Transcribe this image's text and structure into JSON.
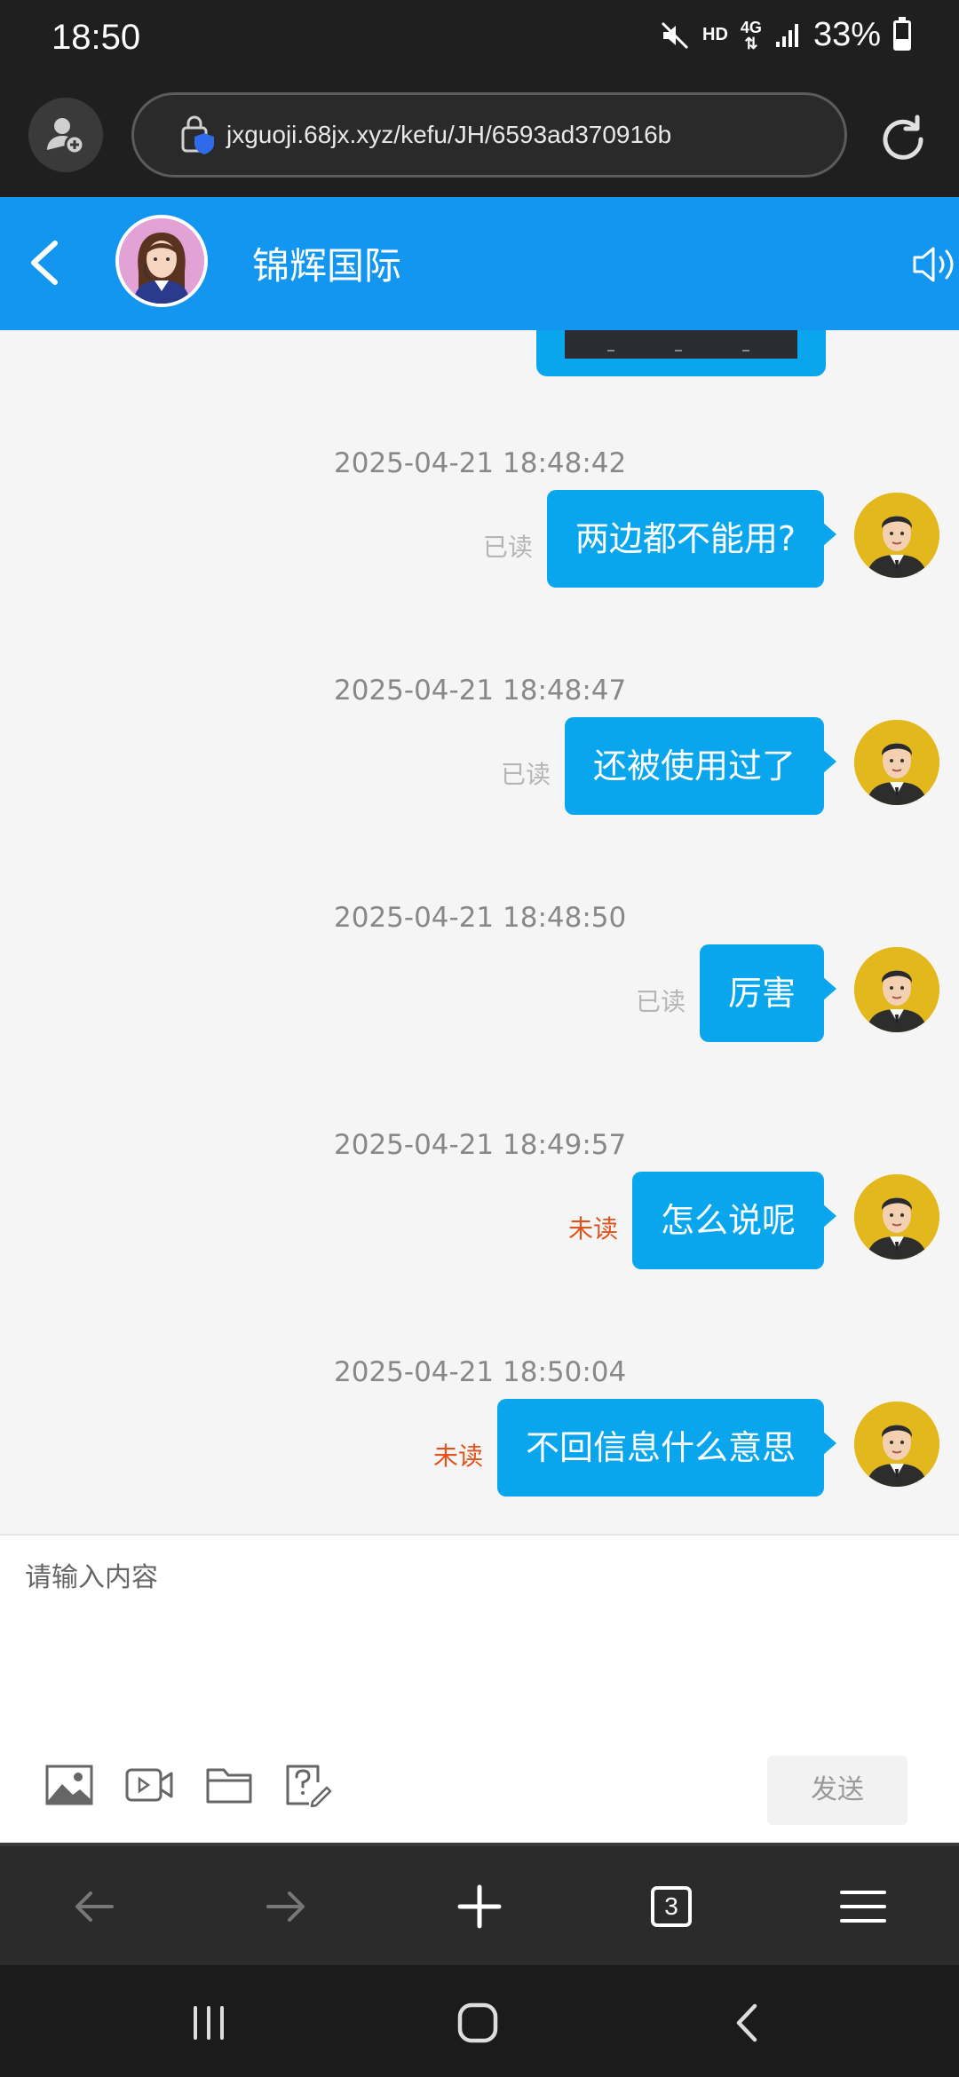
{
  "status_bar": {
    "time": "18:50",
    "hd": "HD",
    "network": "4G",
    "battery": "33%",
    "icons": [
      "mute-icon",
      "signal-icon",
      "battery-icon"
    ]
  },
  "browser": {
    "url": "jxguoji.68jx.xyz/kefu/JH/6593ad370916b",
    "tab_count": "3",
    "icons": [
      "profile-add-icon",
      "secure-lock-icon",
      "reload-icon",
      "back-arrow-icon",
      "forward-arrow-icon",
      "new-tab-icon",
      "tabs-icon",
      "menu-icon"
    ]
  },
  "chat": {
    "title": "锦辉国际",
    "messages": [
      {
        "time": "2025-04-21 18:48:42",
        "status": "已读",
        "text": "两边都不能用?"
      },
      {
        "time": "2025-04-21 18:48:47",
        "status": "已读",
        "text": "还被使用过了"
      },
      {
        "time": "2025-04-21 18:48:50",
        "status": "已读",
        "text": "厉害"
      },
      {
        "time": "2025-04-21 18:49:57",
        "status": "未读",
        "text": "怎么说呢"
      },
      {
        "time": "2025-04-21 18:50:04",
        "status": "未读",
        "text": "不回信息什么意思"
      }
    ]
  },
  "input": {
    "placeholder": "请输入内容",
    "send_label": "发送",
    "tools": [
      "image-icon",
      "video-icon",
      "folder-icon",
      "question-edit-icon"
    ]
  },
  "colors": {
    "header_blue": "#1296f0",
    "bubble_blue": "#09a6ee",
    "unread_orange": "#e0521c",
    "read_gray": "#b5b5b5"
  }
}
